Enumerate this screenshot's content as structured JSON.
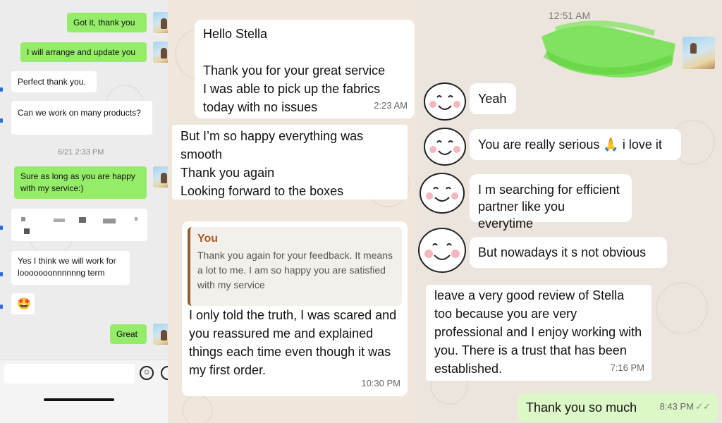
{
  "panel1": {
    "messages": [
      {
        "text": "Got it, thank you"
      },
      {
        "text": "I will arrange and update you"
      },
      {
        "text": "Perfect thank you."
      },
      {
        "text": "Can we work on many products?"
      },
      {
        "text": "Sure as long as you are happy with my service:)"
      },
      {
        "text": "Yes I think we will work for looooooonnnnnng term"
      },
      {
        "text": "🤩"
      },
      {
        "text": "Great"
      }
    ],
    "timestamp": "6/21 2:33 PM",
    "emoji_button": "☺"
  },
  "panel2": {
    "msg1": {
      "text": "Hello Stella\n\nThank you for your great service\nI was able to pick up the fabrics today with no issues",
      "time": "2:23 AM"
    },
    "msg2": {
      "text": "But I’m so happy everything was smooth\nThank you again\nLooking forward to the boxes"
    },
    "reply": {
      "quote_name": "You",
      "quote_text": "Thank you again for your feedback. It means a lot to me. I am so happy you are satisfied with my service",
      "text": "I only told the truth, I was scared and you reassured me and explained things each time even though it was my first order.",
      "time": "10:30 PM"
    }
  },
  "panel3": {
    "time_header": "12:51 AM",
    "messages": [
      {
        "text": "Yeah"
      },
      {
        "text": "You are really serious 🙏 i love it"
      },
      {
        "text": "I m searching for efficient partner like you everytime"
      },
      {
        "text": "But nowadays it s not obvious"
      }
    ],
    "review": {
      "text": "leave a very good review of Stella too because you are very professional and I enjoy working with you. There is a trust that has been established.",
      "time": "7:16 PM"
    },
    "outgoing": {
      "text": "Thank you so much",
      "time": "8:43 PM",
      "ticks": "✓✓"
    }
  },
  "colors": {
    "wechat_green": "#95ec69",
    "whatsapp_out": "#dcf8c6",
    "quote_accent": "#9b5a2c",
    "scribble": "#6fe04a"
  }
}
